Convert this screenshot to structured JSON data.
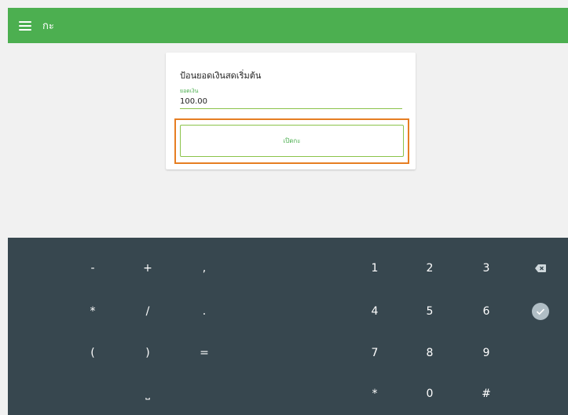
{
  "appbar": {
    "title": "กะ",
    "menu_icon": "hamburger-menu-icon",
    "color": "#4caf50"
  },
  "card": {
    "title": "ป้อนยอดเงินสดเริ่มต้น",
    "field_label": "ยอดเงิน",
    "amount_value": "100.00",
    "button_label": "เปิดกะ",
    "highlight_color": "#e67e22"
  },
  "keypad": {
    "background": "#37474f",
    "symbols": {
      "minus": "-",
      "plus": "+",
      "comma": ",",
      "multiply": "*",
      "divide": "/",
      "period": ".",
      "open_paren": "(",
      "close_paren": ")",
      "equals": "=",
      "space": "⎵"
    },
    "digits": {
      "d1": "1",
      "d2": "2",
      "d3": "3",
      "d4": "4",
      "d5": "5",
      "d6": "6",
      "d7": "7",
      "d8": "8",
      "d9": "9",
      "star": "*",
      "d0": "0",
      "hash": "#"
    },
    "backspace_icon": "backspace-icon",
    "done_icon": "check-circle-icon"
  }
}
